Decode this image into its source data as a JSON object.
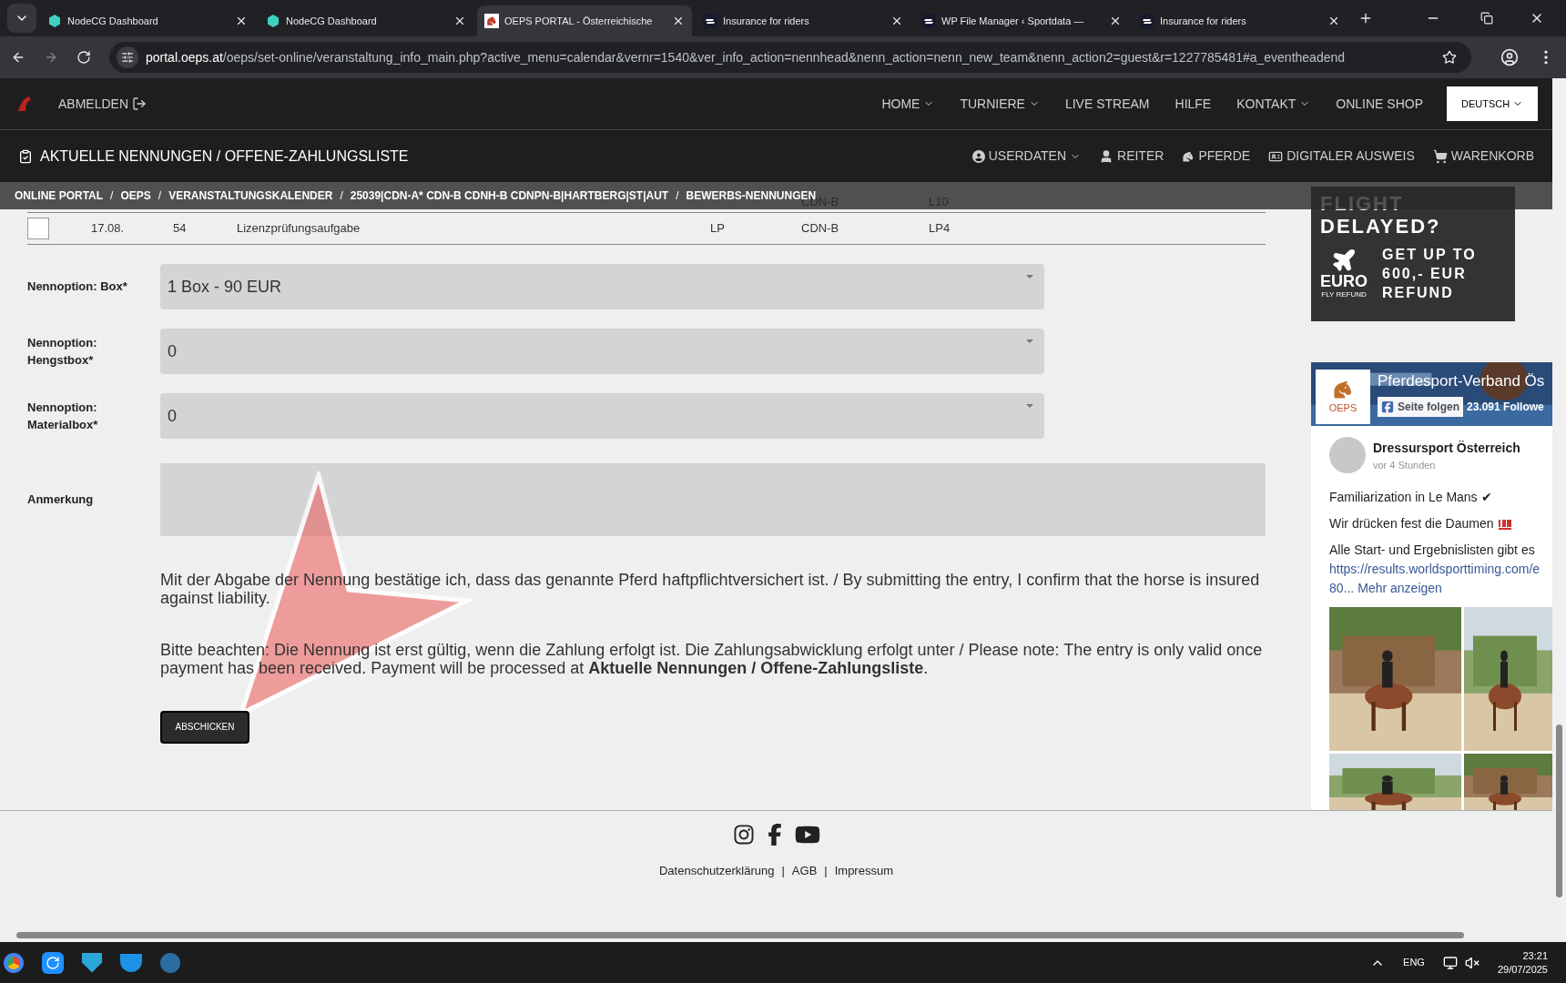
{
  "browser": {
    "tabs": [
      {
        "title": "NodeCG Dashboard",
        "kind": "hexagon",
        "selected": false
      },
      {
        "title": "NodeCG Dashboard",
        "kind": "hexagon",
        "selected": false
      },
      {
        "title": "OEPS PORTAL - Österreichische",
        "kind": "horse",
        "selected": true
      },
      {
        "title": "Insurance for riders",
        "kind": "stripes",
        "selected": false
      },
      {
        "title": "WP File Manager ‹ Sportdata —",
        "kind": "stripes",
        "selected": false
      },
      {
        "title": "Insurance for riders",
        "kind": "stripes",
        "selected": false
      }
    ],
    "url_host": "portal.oeps.at",
    "url_path": "/oeps/set-online/veranstaltung_info_main.php?active_menu=calendar&vernr=1540&ver_info_action=nennhead&nenn_action=nenn_new_team&nenn_action2=guest&r=1227785481#a_eventheadend"
  },
  "site": {
    "logout": "ABMELDEN",
    "nav": [
      {
        "label": "HOME",
        "dropdown": true
      },
      {
        "label": "TURNIERE",
        "dropdown": true
      },
      {
        "label": "LIVE STREAM",
        "dropdown": false
      },
      {
        "label": "HILFE",
        "dropdown": false
      },
      {
        "label": "KONTAKT",
        "dropdown": true
      },
      {
        "label": "ONLINE SHOP",
        "dropdown": false
      }
    ],
    "language": "DEUTSCH",
    "page_title": "AKTUELLE NENNUNGEN / OFFENE-ZAHLUNGSLISTE",
    "user_nav": [
      {
        "label": "USERDATEN",
        "kind": "user-circle",
        "dropdown": true
      },
      {
        "label": "REITER",
        "kind": "user",
        "dropdown": false
      },
      {
        "label": "PFERDE",
        "kind": "horse",
        "dropdown": false
      },
      {
        "label": "DIGITALER AUSWEIS",
        "kind": "id-card",
        "dropdown": false
      },
      {
        "label": "WARENKORB",
        "kind": "cart",
        "dropdown": false
      }
    ],
    "breadcrumb": [
      "ONLINE PORTAL",
      "OEPS",
      "VERANSTALTUNGSKALENDER",
      "25039|CDN-A* CDN-B CDNH-B CDNPN-B|HARTBERG|ST|AUT",
      "BEWERBS-NENNUNGEN"
    ],
    "breadcrumb_separator": "/"
  },
  "table": {
    "rows": [
      {
        "column_5": "CDN-B",
        "column_6": "L10"
      },
      {
        "checked": false,
        "date": "17.08.",
        "number": "54",
        "test": "Lizenzprüfungsaufgabe",
        "column_4": "LP",
        "column_5": "CDN-B",
        "column_6": "LP4"
      }
    ]
  },
  "form": {
    "fields": [
      {
        "kind": "select",
        "label": "Nennoption: Box*",
        "value": "1 Box - 90 EUR"
      },
      {
        "kind": "select",
        "label": "Nennoption: Hengstbox*",
        "value": "0"
      },
      {
        "kind": "select",
        "label": "Nennoption: Materialbox*",
        "value": "0"
      },
      {
        "kind": "textarea",
        "label": "Anmerkung"
      }
    ],
    "notices": [
      "Mit der Abgabe der Nennung bestätige ich, dass das genannte Pferd haftpflichtversichert ist. / By submitting the entry, I confirm that the horse is insured against liability.",
      "Bitte beachten: Die Nennung ist erst gültig, wenn die Zahlung erfolgt ist. Die Zahlungsabwicklung erfolgt unter / Please note: The entry is only valid once payment has been received. Payment will be processed at **Aktuelle Nennungen / Offene-Zahlungsliste**."
    ],
    "submit": "ABSCHICKEN"
  },
  "ad": {
    "headline": [
      "FLIGHT",
      "DELAYED?"
    ],
    "offer": [
      "GET UP TO",
      "600,- EUR",
      "REFUND"
    ],
    "brand": "EURO",
    "brand_sub": "FLY REFUND"
  },
  "facebook": {
    "logo": "OEPS",
    "page_name": "Pferdesport-Verband Ös",
    "follow": "Seite folgen",
    "followers": "23.091 Followe",
    "post": {
      "author": "Dressursport Österreich",
      "time": "vor 4 Stunden",
      "lines": [
        "Familiarization in Le Mans ✔",
        "Wir drücken fest die Daumen",
        "Alle Start- und Ergebnislisten gibt es"
      ],
      "link": "https://results.worldsporttiming.com/e",
      "link_end": "80...",
      "more": "Mehr anzeigen"
    }
  },
  "footer": {
    "links": [
      "Datenschutzerklärung",
      "AGB",
      "Impressum"
    ],
    "separator": "|"
  },
  "taskbar": {
    "language": "ENG",
    "time": "23:21",
    "date": "29/07/2025"
  }
}
